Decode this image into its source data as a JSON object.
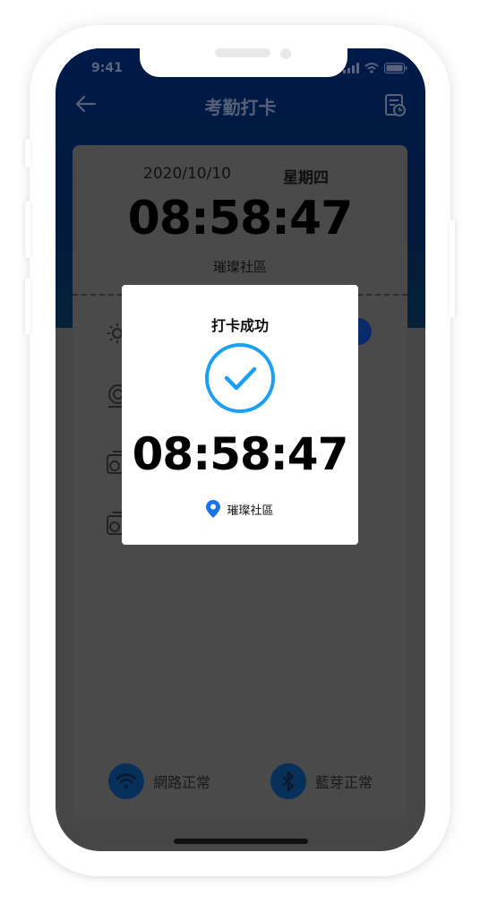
{
  "status_bar": {
    "time": "9:41"
  },
  "header": {
    "title": "考勤打卡"
  },
  "card": {
    "date": "2020/10/10",
    "weekday": "星期四",
    "clock": "08:58:47",
    "location": "璀璨社區"
  },
  "footer": {
    "network_label": "網路正常",
    "bluetooth_label": "藍芽正常"
  },
  "modal": {
    "title": "打卡成功",
    "time": "08:58:47",
    "location": "璀璨社區"
  },
  "colors": {
    "accent": "#1aa0f0",
    "header_dark": "#001a4a",
    "pin_blue": "#1a73e8"
  }
}
